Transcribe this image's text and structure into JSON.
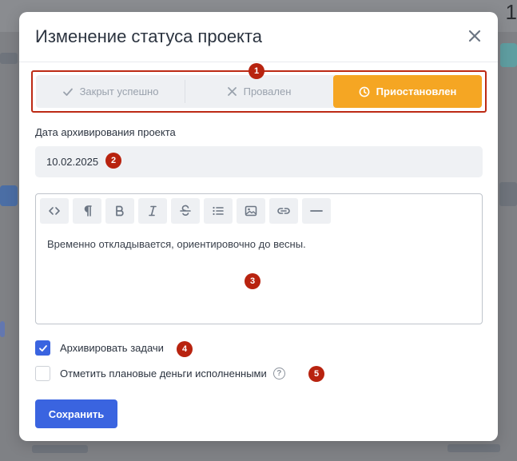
{
  "background": {
    "corner_text": "1"
  },
  "modal": {
    "title": "Изменение статуса проекта",
    "close_icon": "close-icon",
    "status": {
      "options": [
        {
          "label": "Закрыт успешно",
          "icon": "check-icon"
        },
        {
          "label": "Провален",
          "icon": "x-icon"
        },
        {
          "label": "Приостановлен",
          "icon": "clock-icon",
          "selected": true
        }
      ],
      "accent": "#f5a623"
    },
    "archive_date": {
      "label": "Дата архивирования проекта",
      "value": "10.02.2025"
    },
    "editor": {
      "toolbar": [
        "code-icon",
        "paragraph-icon",
        "bold-icon",
        "italic-icon",
        "strikethrough-icon",
        "list-icon",
        "image-icon",
        "link-icon",
        "horizontal-rule-icon"
      ],
      "content": "Временно откладывается, ориентировочно до весны."
    },
    "checkboxes": [
      {
        "label": "Архивировать задачи",
        "checked": true
      },
      {
        "label": "Отметить плановые деньги исполненными",
        "checked": false,
        "help": "?"
      }
    ],
    "save_label": "Сохранить",
    "primary_color": "#3a64e0"
  },
  "annotations": [
    "1",
    "2",
    "3",
    "4",
    "5"
  ]
}
